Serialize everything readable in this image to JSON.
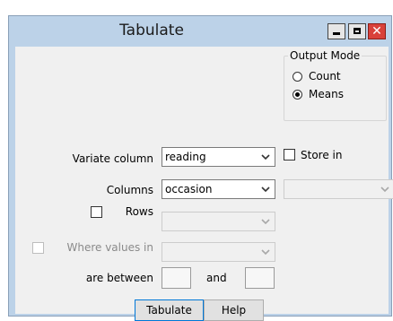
{
  "window": {
    "title": "Tabulate"
  },
  "output_mode": {
    "legend": "Output Mode",
    "options": [
      {
        "label": "Count",
        "selected": false
      },
      {
        "label": "Means",
        "selected": true
      }
    ]
  },
  "form": {
    "variate_label": "Variate column",
    "variate_value": "reading",
    "store_in_label": "Store in",
    "columns_label": "Columns",
    "columns_value": "occasion",
    "rows_label": "Rows",
    "where_values_label": "Where values in",
    "between_label": "are between",
    "and_label": "and"
  },
  "buttons": {
    "tabulate": "Tabulate",
    "help": "Help"
  },
  "colors": {
    "title_bg": "#bcd2e8",
    "close": "#d9413a",
    "focus": "#0078d7"
  }
}
